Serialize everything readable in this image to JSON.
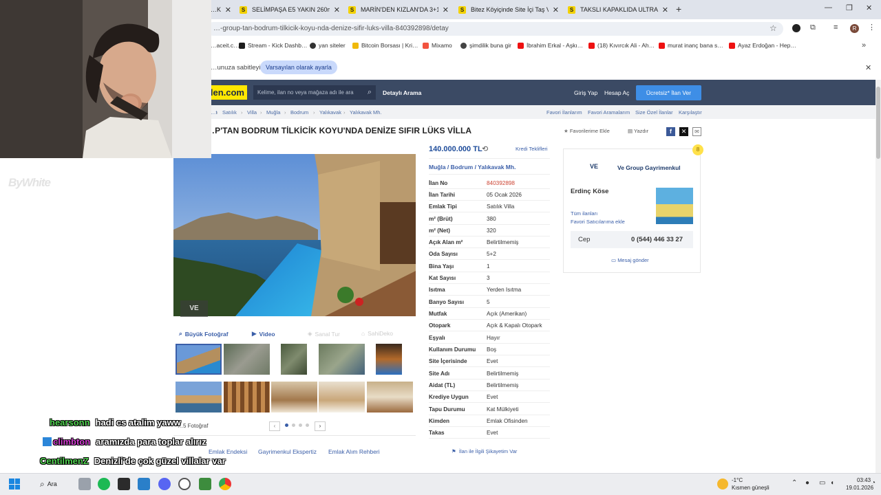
{
  "browser": {
    "tabs": [
      {
        "title": "…KI",
        "active": false
      },
      {
        "title": "SELİMPAŞA E5 YAKIN 260m mü",
        "active": false
      },
      {
        "title": "MARİN'DEN KIZLAN'DA 3+1 O",
        "active": false
      },
      {
        "title": "Bitez Köyiçinde Site İçi Taş Villa",
        "active": false
      },
      {
        "title": "TAKSLI KAPAKLIDA ULTRA LÜKS",
        "active": false
      }
    ],
    "new_tab": "+",
    "url": "…-group-tan-bodrum-tilkicik-koyu-nda-denize-sifir-luks-villa-840392898/detay",
    "avatar_letter": "R",
    "bookmarks": [
      "…aceit.c…",
      "Stream - Kick Dashb…",
      "yan siteler",
      "Bitcoin Borsası | Kri…",
      "Mixamo",
      "şimdilik buna gir",
      "İbrahim Erkal - Aşkı…",
      "(18) Kıvırcık Ali - Ah…",
      "murat inanç bana s…",
      "Ayaz Erdoğan - Hep…"
    ],
    "bookmarks_more": "»",
    "infobar_text": "…unuza sabitleyin",
    "infobar_button": "Varsayılan olarak ayarla",
    "infobar_close": "✕"
  },
  "site": {
    "logo_text": "den.com",
    "search_placeholder": "Kelime, ilan no veya mağaza adı ile ara",
    "detailed_search": "Detaylı Arama",
    "login": "Giriş Yap",
    "register": "Hesap Aç",
    "cta": "Ücretsiz* İlan Ver",
    "breadcrumb": [
      "…t",
      "Satılık",
      "Villa",
      "Muğla",
      "Bodrum",
      "Yalıkavak",
      "Yalıkavak Mh."
    ],
    "right_links": [
      "Favori İlanlarım",
      "Favori Aramalarım",
      "Size Özel İlanlar",
      "Karşılaştır"
    ],
    "title": "…P'TAN BODRUM TİLKİCİK KOYU'NDA DENİZE SIFIR LÜKS VİLLA",
    "favorite_label": "Favorilerime Ekle",
    "print_label": "Yazdır"
  },
  "gallery": {
    "big_photo": "Büyük Fotoğraf",
    "video": "Video",
    "virtual_tour": "Sanal Tur",
    "sahibinden_go": "SahiDeko",
    "photo_count": "…5 Fotoğraf",
    "pager_prev": "‹",
    "pager_next": "›",
    "watermark": "VE"
  },
  "listing": {
    "price": "140.000.000 TL",
    "credit_link": "Kredi Teklifleri",
    "location": "Muğla  /  Bodrum  /  Yalıkavak Mh.",
    "details": [
      {
        "k": "İlan No",
        "v": "840392898"
      },
      {
        "k": "İlan Tarihi",
        "v": "05 Ocak 2026"
      },
      {
        "k": "Emlak Tipi",
        "v": "Satılık Villa"
      },
      {
        "k": "m² (Brüt)",
        "v": "380"
      },
      {
        "k": "m² (Net)",
        "v": "320"
      },
      {
        "k": "Açık Alan m²",
        "v": "Belirtilmemiş"
      },
      {
        "k": "Oda Sayısı",
        "v": "5+2"
      },
      {
        "k": "Bina Yaşı",
        "v": "1"
      },
      {
        "k": "Kat Sayısı",
        "v": "3"
      },
      {
        "k": "Isıtma",
        "v": "Yerden Isıtma"
      },
      {
        "k": "Banyo Sayısı",
        "v": "5"
      },
      {
        "k": "Mutfak",
        "v": "Açık (Amerikan)"
      },
      {
        "k": "Otopark",
        "v": "Açık & Kapalı Otopark"
      },
      {
        "k": "Eşyalı",
        "v": "Hayır"
      },
      {
        "k": "Kullanım Durumu",
        "v": "Boş"
      },
      {
        "k": "Site İçerisinde",
        "v": "Evet"
      },
      {
        "k": "Site Adı",
        "v": "Belirtilmemiş"
      },
      {
        "k": "Aidat (TL)",
        "v": "Belirtilmemiş"
      },
      {
        "k": "Krediye Uygun",
        "v": "Evet"
      },
      {
        "k": "Tapu Durumu",
        "v": "Kat Mülkiyeti"
      },
      {
        "k": "Kimden",
        "v": "Emlak Ofisinden"
      },
      {
        "k": "Takas",
        "v": "Evet"
      }
    ],
    "complaint": "İlan ile İlgili Şikayetim Var"
  },
  "seller": {
    "agency": "Ve Group Gayrimenkul",
    "agency_logo": "VE",
    "agent": "Erdinç Köse",
    "all_listings": "Tüm ilanları",
    "add_fav_seller": "Favori Satıcılarıma ekle",
    "phone_label": "Cep",
    "phone": "0 (544) 446 33 27",
    "message": "Mesaj gönder",
    "badge": "8"
  },
  "bottom_links": [
    "Emlak Endeksi",
    "Gayrimenkul Ekspertiz",
    "Emlak Alım Rehberi"
  ],
  "overlay": {
    "watermark": "ByWhite",
    "chat": [
      {
        "user": "hearsonn",
        "msg": "hadi cs atalim yaww",
        "color": "#52d452"
      },
      {
        "user": "climbton",
        "msg": "aramızda para toplar alırız",
        "color": "#d640d6"
      },
      {
        "user": "CentilmenZ",
        "msg": "Denizli'de çok güzel villalar var",
        "color": "#52d452"
      }
    ]
  },
  "taskbar": {
    "search": "Ara",
    "weather_temp": "-1°C",
    "weather_text": "Kısmen güneşli",
    "time": "03:43",
    "date": "19.01.2026"
  },
  "colors": {
    "accent": "#3e8ee6",
    "header": "#3b4a64",
    "logo": "#ffe800",
    "link": "#3a5ea8"
  }
}
